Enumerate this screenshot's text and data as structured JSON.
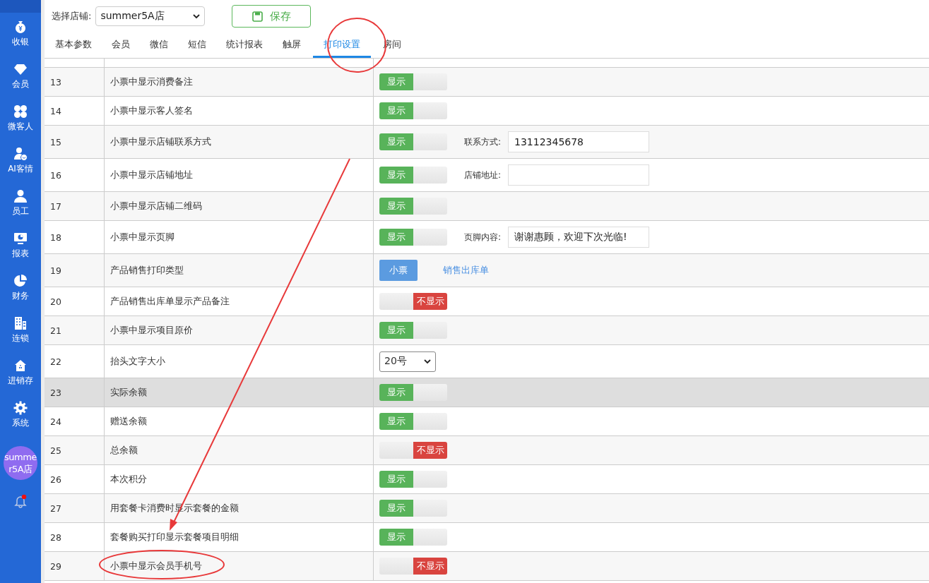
{
  "sidebar": {
    "items": [
      {
        "label": "收银"
      },
      {
        "label": "会员"
      },
      {
        "label": "微客人"
      },
      {
        "label": "AI客情"
      },
      {
        "label": "员工"
      },
      {
        "label": "报表"
      },
      {
        "label": "财务"
      },
      {
        "label": "连锁"
      },
      {
        "label": "进销存"
      },
      {
        "label": "系统"
      }
    ],
    "avatar": "summer5A店",
    "notifications": true
  },
  "toolbar": {
    "store_label": "选择店铺:",
    "store_value": "summer5A店",
    "save_label": "保存"
  },
  "tabs": [
    {
      "label": "基本参数",
      "selected": false
    },
    {
      "label": "会员",
      "selected": false
    },
    {
      "label": "微信",
      "selected": false
    },
    {
      "label": "短信",
      "selected": false
    },
    {
      "label": "统计报表",
      "selected": false
    },
    {
      "label": "触屏",
      "selected": false
    },
    {
      "label": "打印设置",
      "selected": true
    },
    {
      "label": "房间",
      "selected": false
    }
  ],
  "table": {
    "rows": [
      {
        "no": "13",
        "label": "小票中显示消费备注",
        "kind": "toggle",
        "on": true,
        "toggle_label": "显示",
        "highlighted": false
      },
      {
        "no": "14",
        "label": "小票中显示客人签名",
        "kind": "toggle",
        "on": true,
        "toggle_label": "显示",
        "highlighted": false
      },
      {
        "no": "15",
        "label": "小票中显示店铺联系方式",
        "kind": "toggle",
        "on": true,
        "toggle_label": "显示",
        "highlighted": false,
        "field": {
          "label": "联系方式:",
          "value": "13112345678"
        }
      },
      {
        "no": "16",
        "label": "小票中显示店铺地址",
        "kind": "toggle",
        "on": true,
        "toggle_label": "显示",
        "highlighted": false,
        "field": {
          "label": "店铺地址:"
        }
      },
      {
        "no": "17",
        "label": "小票中显示店铺二维码",
        "kind": "toggle",
        "on": true,
        "toggle_label": "显示",
        "highlighted": false
      },
      {
        "no": "18",
        "label": "小票中显示页脚",
        "kind": "toggle",
        "on": true,
        "toggle_label": "显示",
        "highlighted": false,
        "field": {
          "label": "页脚内容:",
          "value": "谢谢惠顾，欢迎下次光临!"
        }
      },
      {
        "no": "19",
        "label": "产品销售打印类型",
        "kind": "choice",
        "highlighted": false,
        "options": [
          {
            "label": "小票",
            "selected": true
          },
          {
            "label": "销售出库单",
            "selected": false
          }
        ]
      },
      {
        "no": "20",
        "label": "产品销售出库单显示产品备注",
        "kind": "toggle",
        "on": false,
        "toggle_label": "不显示",
        "highlighted": false
      },
      {
        "no": "21",
        "label": "小票中显示项目原价",
        "kind": "toggle",
        "on": true,
        "toggle_label": "显示",
        "highlighted": false
      },
      {
        "no": "22",
        "label": "抬头文字大小",
        "kind": "select",
        "value": "20号",
        "highlighted": false
      },
      {
        "no": "23",
        "label": "实际余额",
        "kind": "toggle",
        "on": true,
        "toggle_label": "显示",
        "highlighted": true
      },
      {
        "no": "24",
        "label": "赠送余额",
        "kind": "toggle",
        "on": true,
        "toggle_label": "显示",
        "highlighted": false
      },
      {
        "no": "25",
        "label": "总余额",
        "kind": "toggle",
        "on": false,
        "toggle_label": "不显示",
        "highlighted": false
      },
      {
        "no": "26",
        "label": "本次积分",
        "kind": "toggle",
        "on": true,
        "toggle_label": "显示",
        "highlighted": false
      },
      {
        "no": "27",
        "label": "用套餐卡消费时显示套餐的金额",
        "kind": "toggle",
        "on": true,
        "toggle_label": "显示",
        "highlighted": false
      },
      {
        "no": "28",
        "label": "套餐购买打印显示套餐项目明细",
        "kind": "toggle",
        "on": true,
        "toggle_label": "显示",
        "highlighted": false
      },
      {
        "no": "29",
        "label": "小票中显示会员手机号",
        "kind": "toggle",
        "on": false,
        "toggle_label": "不显示",
        "highlighted": false
      }
    ]
  }
}
